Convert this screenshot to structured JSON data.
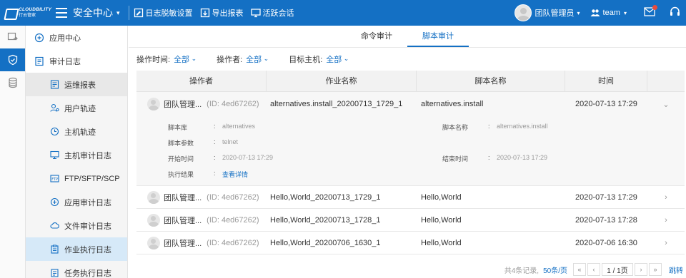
{
  "header": {
    "logo_en": "CLOUDBILITY",
    "logo_cn": "行云管家",
    "app_title": "安全中心",
    "tools": [
      {
        "label": "日志脱敏设置",
        "icon": "shield-edit-icon"
      },
      {
        "label": "导出报表",
        "icon": "export-icon"
      },
      {
        "label": "活跃会话",
        "icon": "monitor-icon"
      }
    ],
    "user_name": "团队管理员",
    "team_name": "team"
  },
  "rail": [
    "app-switch-icon",
    "security-shield-icon",
    "database-icon"
  ],
  "sidebar": {
    "items": [
      {
        "label": "应用中心",
        "level": "top",
        "icon": "app-center-icon"
      },
      {
        "label": "审计日志",
        "level": "top",
        "icon": "audit-log-icon"
      },
      {
        "label": "运维报表",
        "level": "sub",
        "icon": "report-icon",
        "state": "hover"
      },
      {
        "label": "用户轨迹",
        "level": "sub",
        "icon": "user-track-icon"
      },
      {
        "label": "主机轨迹",
        "level": "sub",
        "icon": "host-track-icon"
      },
      {
        "label": "主机审计日志",
        "level": "sub",
        "icon": "host-audit-icon"
      },
      {
        "label": "FTP/SFTP/SCP",
        "level": "sub",
        "icon": "ftp-icon"
      },
      {
        "label": "应用审计日志",
        "level": "sub",
        "icon": "app-audit-icon"
      },
      {
        "label": "文件审计日志",
        "level": "sub",
        "icon": "cloud-file-icon"
      },
      {
        "label": "作业执行日志",
        "level": "sub",
        "icon": "job-log-icon",
        "state": "active"
      },
      {
        "label": "任务执行日志",
        "level": "sub",
        "icon": "task-log-icon"
      }
    ]
  },
  "tabs": [
    {
      "label": "命令审计",
      "active": false
    },
    {
      "label": "脚本审计",
      "active": true
    }
  ],
  "filters": [
    {
      "label": "操作时间:",
      "value": "全部"
    },
    {
      "label": "操作者:",
      "value": "全部"
    },
    {
      "label": "目标主机:",
      "value": "全部"
    }
  ],
  "table": {
    "columns": [
      "操作者",
      "作业名称",
      "脚本名称",
      "时间",
      ""
    ],
    "rows": [
      {
        "operator": "团队管理...",
        "id": "(ID: 4ed67262)",
        "task": "alternatives.install_20200713_1729_1",
        "script": "alternatives.install",
        "time": "2020-07-13 17:29",
        "expanded": true
      },
      {
        "operator": "团队管理...",
        "id": "(ID: 4ed67262)",
        "task": "Hello,World_20200713_1729_1",
        "script": "Hello,World",
        "time": "2020-07-13 17:29",
        "expanded": false
      },
      {
        "operator": "团队管理...",
        "id": "(ID: 4ed67262)",
        "task": "Hello,World_20200713_1728_1",
        "script": "Hello,World",
        "time": "2020-07-13 17:28",
        "expanded": false
      },
      {
        "operator": "团队管理...",
        "id": "(ID: 4ed67262)",
        "task": "Hello,World_20200706_1630_1",
        "script": "Hello,World",
        "time": "2020-07-06 16:30",
        "expanded": false
      }
    ],
    "detail": {
      "repo_key": "脚本库",
      "repo_val": "alternatives",
      "params_key": "脚本参数",
      "params_val": "telnet",
      "start_key": "开始时间",
      "start_val": "2020-07-13 17:29",
      "result_key": "执行结果",
      "result_val": "查看详情",
      "name_key": "脚本名称",
      "name_val": "alternatives.install",
      "end_key": "结束时间",
      "end_val": "2020-07-13 17:29",
      "colon": ":"
    }
  },
  "pager": {
    "total": "共4条记录,",
    "page_size": "50条/页",
    "page": "1 / 1页",
    "jump": "跳转"
  },
  "colors": {
    "primary": "#1470c4",
    "active_row": "#d6e9f8",
    "link": "#1470c4"
  }
}
